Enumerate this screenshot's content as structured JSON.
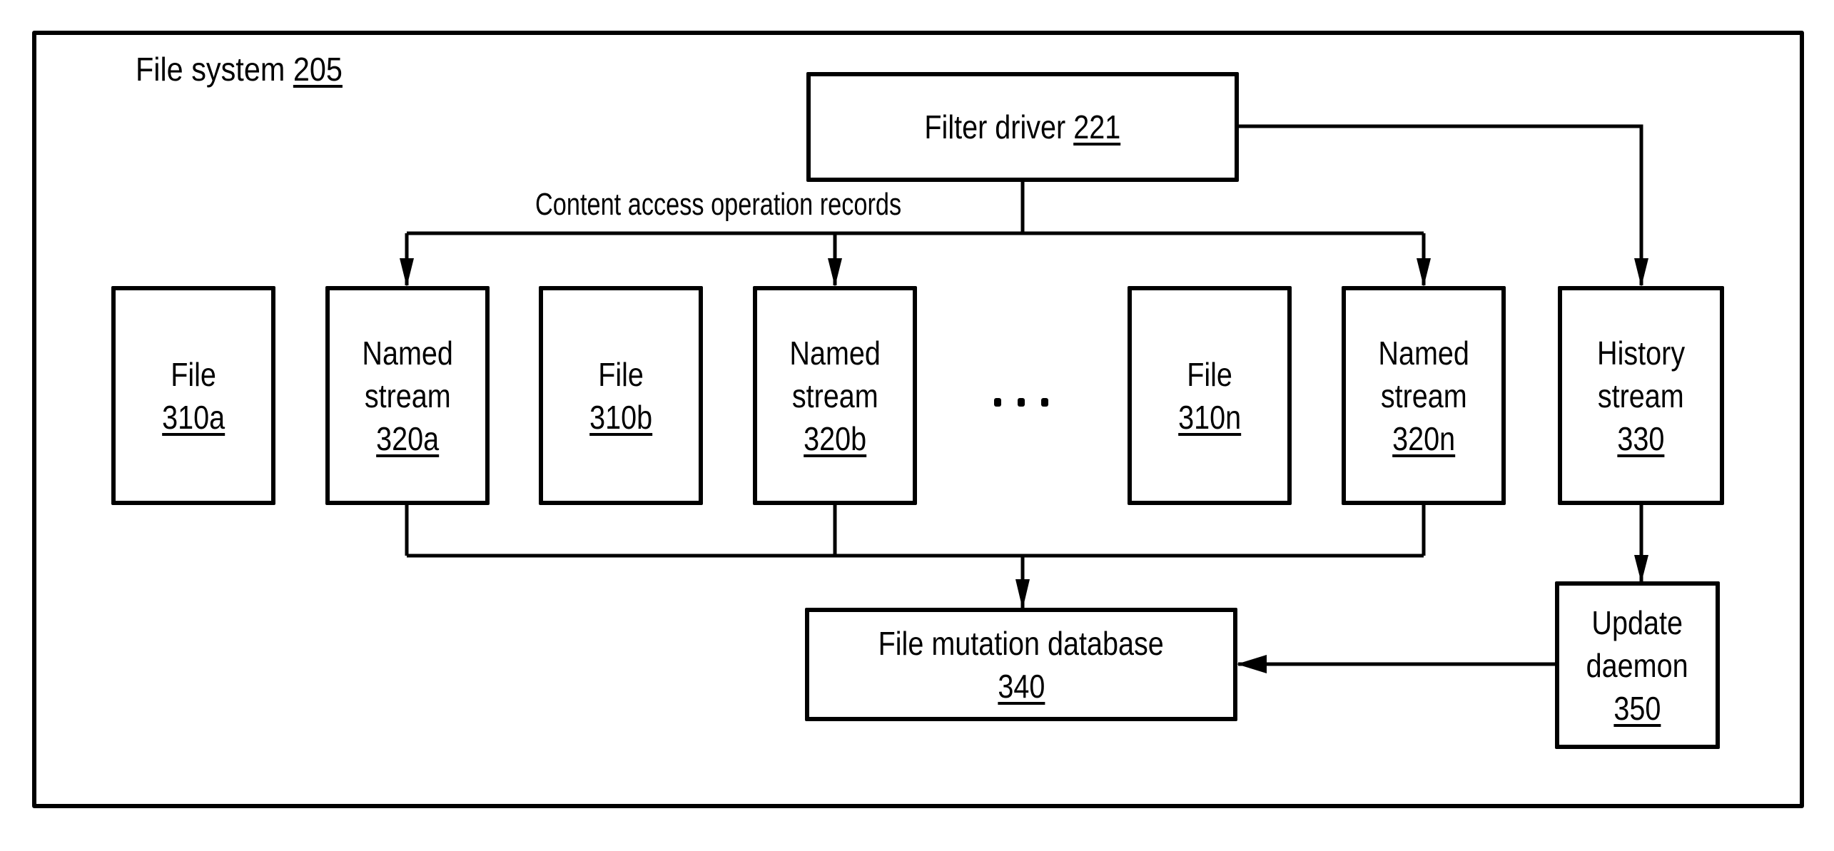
{
  "container": {
    "label": "File system",
    "ref": "205"
  },
  "filter_driver": {
    "label": "Filter driver",
    "ref": "221"
  },
  "edge_label": "Content access operation records",
  "row_boxes": [
    {
      "id": "file-310a",
      "lines": [
        "File"
      ],
      "ref": "310a"
    },
    {
      "id": "named-stream-320a",
      "lines": [
        "Named",
        "stream"
      ],
      "ref": "320a"
    },
    {
      "id": "file-310b",
      "lines": [
        "File"
      ],
      "ref": "310b"
    },
    {
      "id": "named-stream-320b",
      "lines": [
        "Named",
        "stream"
      ],
      "ref": "320b"
    },
    {
      "id": "file-310n",
      "lines": [
        "File"
      ],
      "ref": "310n"
    },
    {
      "id": "named-stream-320n",
      "lines": [
        "Named",
        "stream"
      ],
      "ref": "320n"
    },
    {
      "id": "history-stream-330",
      "lines": [
        "History",
        "stream"
      ],
      "ref": "330"
    }
  ],
  "ellipsis": "...",
  "mutation_db": {
    "label": "File mutation database",
    "ref": "340"
  },
  "update_daemon": {
    "lines": [
      "Update",
      "daemon"
    ],
    "ref": "350"
  },
  "edges": [
    {
      "from": "filter-driver-221",
      "to": "named-stream-320a",
      "label": "Content access operation records"
    },
    {
      "from": "filter-driver-221",
      "to": "named-stream-320b"
    },
    {
      "from": "filter-driver-221",
      "to": "named-stream-320n"
    },
    {
      "from": "filter-driver-221",
      "to": "history-stream-330"
    },
    {
      "from": "named-stream-320a",
      "to": "file-mutation-database-340"
    },
    {
      "from": "named-stream-320b",
      "to": "file-mutation-database-340"
    },
    {
      "from": "named-stream-320n",
      "to": "file-mutation-database-340"
    },
    {
      "from": "history-stream-330",
      "to": "update-daemon-350"
    },
    {
      "from": "update-daemon-350",
      "to": "file-mutation-database-340"
    }
  ]
}
